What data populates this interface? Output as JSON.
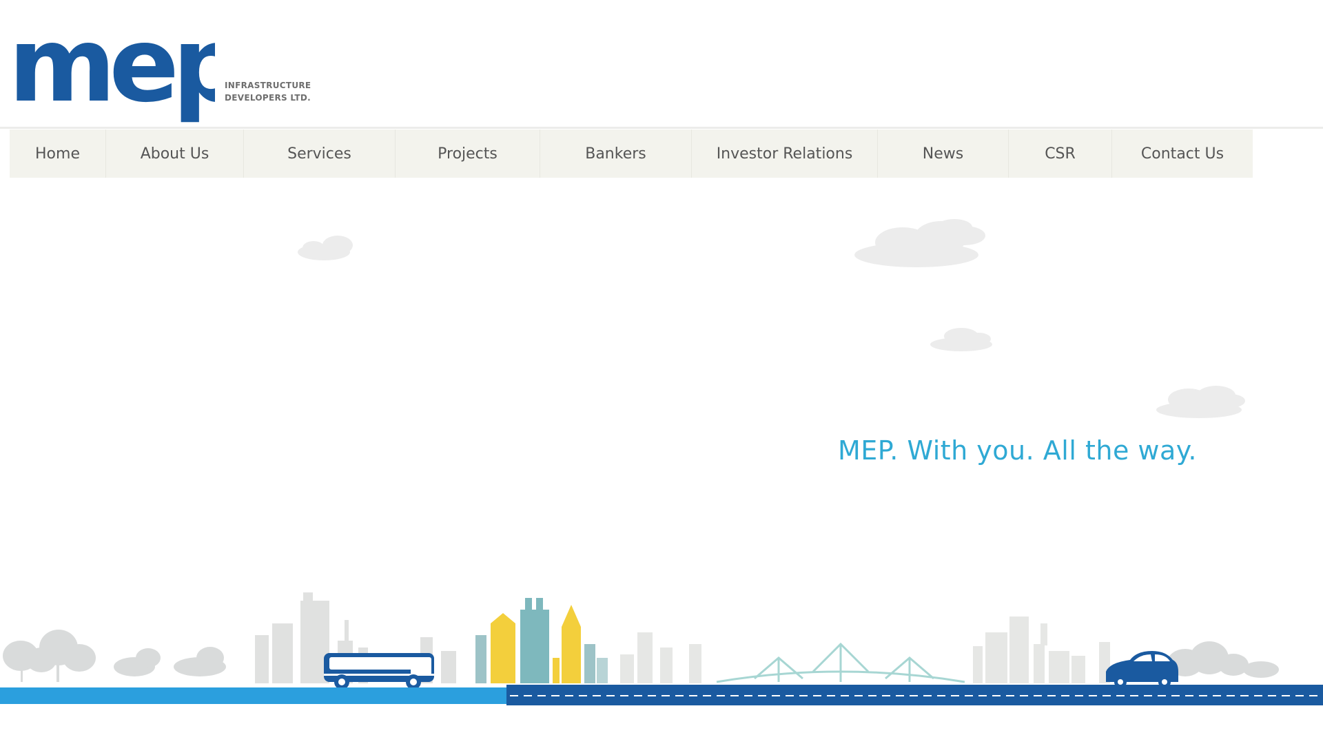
{
  "brand": {
    "logo_text": "mep",
    "sub_line1": "INFRASTRUCTURE",
    "sub_line2": "DEVELOPERS LTD.",
    "color": "#1a5aa0"
  },
  "nav": {
    "items": [
      {
        "label": "Home"
      },
      {
        "label": "About Us"
      },
      {
        "label": "Services"
      },
      {
        "label": "Projects"
      },
      {
        "label": "Bankers"
      },
      {
        "label": "Investor Relations"
      },
      {
        "label": "News"
      },
      {
        "label": "CSR"
      },
      {
        "label": "Contact Us"
      }
    ]
  },
  "hero": {
    "tagline": "MEP. With you. All the way.",
    "tagline_color": "#2fa9d4"
  },
  "illustration": {
    "road_left_color": "#2b9fde",
    "road_right_color": "#1a5aa0",
    "accent_yellow": "#f3cf3c",
    "accent_teal": "#7eb8bd",
    "icons": [
      "cloud-icon",
      "tree-icon",
      "building-icon",
      "bus-icon",
      "bridge-icon",
      "car-icon"
    ]
  }
}
